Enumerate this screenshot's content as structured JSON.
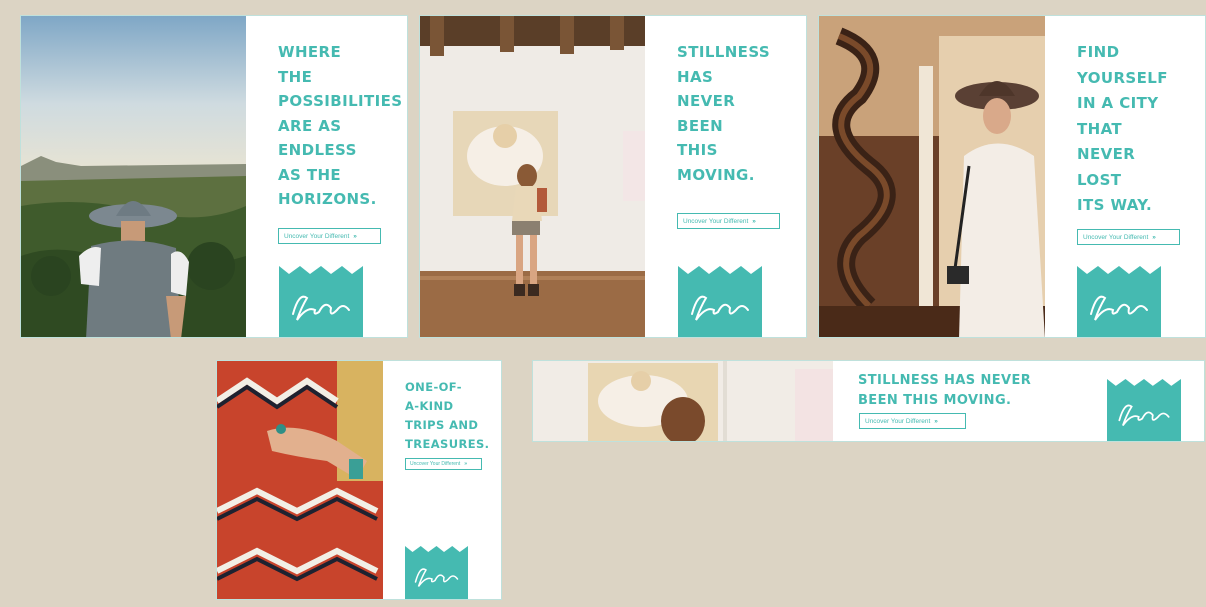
{
  "brand": {
    "accent": "#45bab1",
    "background": "#dcd4c4",
    "panel": "#ffffff"
  },
  "ads": {
    "horizons": {
      "headline": "WHERE\nTHE\nPOSSIBILITIES\nARE AS\nENDLESS\nAS THE\nHORIZONS.",
      "cta": "Uncover Your Different",
      "logo": "Santa Fe"
    },
    "gallery": {
      "headline": "STILLNESS\nHAS\nNEVER\nBEEN\nTHIS\nMOVING.",
      "cta": "Uncover Your Different",
      "logo": "Santa Fe"
    },
    "city": {
      "headline": "FIND\nYOURSELF\nIN A CITY\nTHAT\nNEVER\nLOST\nITS WAY.",
      "cta": "Uncover Your Different",
      "logo": "Santa Fe"
    },
    "treasures": {
      "headline": "ONE-OF-\nA-KIND\nTRIPS AND\nTREASURES.",
      "cta": "Uncover Your Different",
      "logo": "Santa Fe"
    },
    "leaderboard": {
      "headline": "STILLNESS HAS NEVER\nBEEN THIS MOVING.",
      "cta": "Uncover Your Different",
      "logo": "Santa Fe"
    }
  },
  "icons": {
    "cta_arrow": "chevron-double-right-icon",
    "logo_icon": "santa-fe-logo-icon"
  }
}
